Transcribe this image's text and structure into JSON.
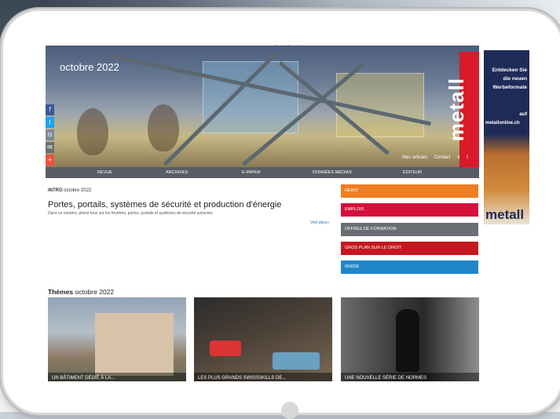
{
  "background": {
    "left_text_1": "n",
    "left_text_2": "ri"
  },
  "hero": {
    "issue": "octobre 2022",
    "brand": "metall",
    "links": [
      "Mes articles",
      "Contact",
      "d",
      "f"
    ]
  },
  "social": [
    "f",
    "t",
    "⊙",
    "✉",
    "+"
  ],
  "nav": [
    "REVUE",
    "ARCHIVES",
    "E-PAPER",
    "DONNÉES MÉDIAS",
    "ÉDITEUR"
  ],
  "intro": {
    "tag_bold": "INTRO",
    "tag_date": "octobre 2022",
    "title": "Portes, portails, systèmes de sécurité et production d'énergie",
    "text": "Dans ce numéro, pleins feux sur les fenêtres, portes, portails et systèmes de sécurité associés.",
    "more": "Voir plus»"
  },
  "side_menu": [
    {
      "label": "NEWS",
      "color": "#ef7d22"
    },
    {
      "label": "EMPLOIS",
      "color": "#d5103b"
    },
    {
      "label": "OFFRES DE FORMATION",
      "color": "#6a6e73"
    },
    {
      "label": "GROS PLAN SUR LE DROIT",
      "color": "#c5171f"
    },
    {
      "label": "INSIDE",
      "color": "#1f86c9"
    }
  ],
  "ad": {
    "l1": "Entdecken Sie",
    "l2": "die neuen",
    "l3": "Werbeformate",
    "l4": "auf",
    "l5": "metallonline.ch",
    "logo": "metall"
  },
  "themes": {
    "title_bold": "Thèmes",
    "title_date": "octobre 2022",
    "cards": [
      {
        "caption": "UN BÂTIMENT DÉDIÉ À LA..."
      },
      {
        "caption": "LES PLUS GRANDS SWISSSKILLS DE..."
      },
      {
        "caption": "UNE NOUVELLE SÉRIE DE NORMES"
      }
    ]
  }
}
